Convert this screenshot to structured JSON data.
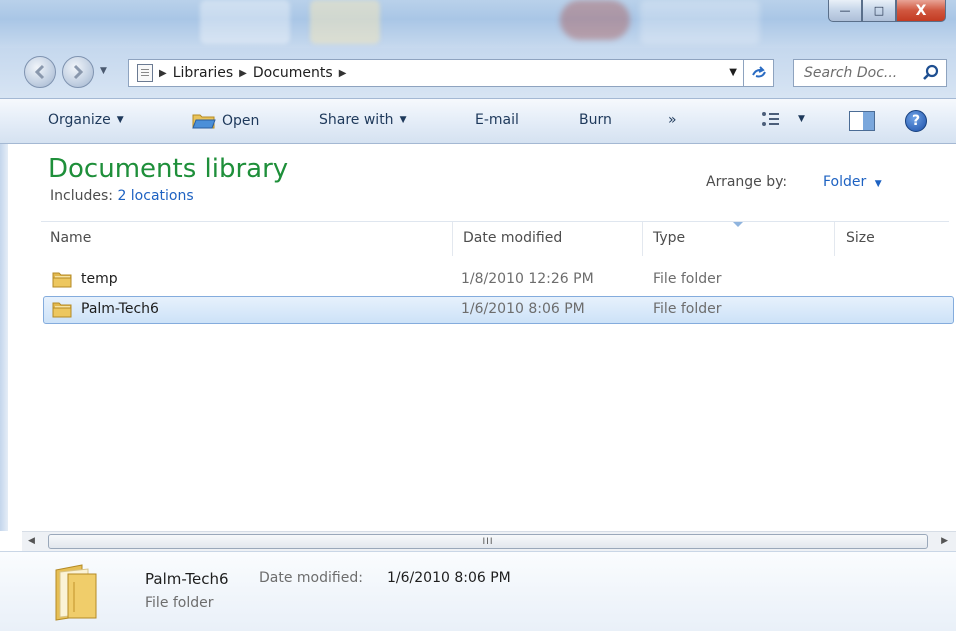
{
  "window": {
    "minimize_glyph": "—",
    "maximize_glyph": "□",
    "close_glyph": "X"
  },
  "nav": {
    "back_icon": "back-arrow-icon",
    "forward_icon": "forward-arrow-icon"
  },
  "address": {
    "breadcrumbs": [
      "Libraries",
      "Documents"
    ]
  },
  "search": {
    "placeholder": "Search Doc..."
  },
  "toolbar": {
    "organize": "Organize",
    "open": "Open",
    "share_with": "Share with",
    "email": "E-mail",
    "burn": "Burn",
    "more": "»"
  },
  "library": {
    "title": "Documents library",
    "includes_label": "Includes:",
    "includes_link": "2 locations",
    "arrange_label": "Arrange by:",
    "arrange_value": "Folder"
  },
  "columns": {
    "name": "Name",
    "date": "Date modified",
    "type": "Type",
    "size": "Size"
  },
  "files": [
    {
      "name": "temp",
      "date": "1/8/2010 12:26 PM",
      "type": "File folder"
    },
    {
      "name": "Palm-Tech6",
      "date": "1/6/2010 8:06 PM",
      "type": "File folder"
    }
  ],
  "scrollbar": {
    "grip": "III"
  },
  "details": {
    "name": "Palm-Tech6",
    "date_label": "Date modified:",
    "date_value": "1/6/2010 8:06 PM",
    "type": "File folder"
  },
  "colors": {
    "title_green": "#1e8f3a",
    "link_blue": "#1e62c2",
    "selection": "#cde2f8"
  }
}
